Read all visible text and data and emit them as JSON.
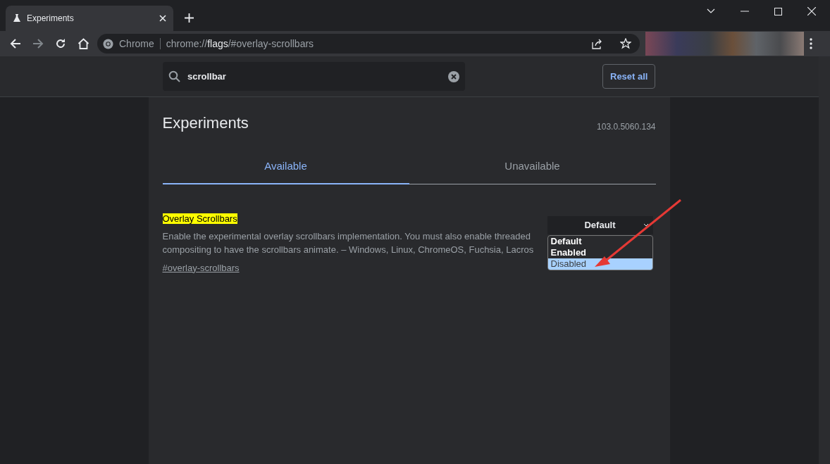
{
  "browser": {
    "tab_title": "Experiments",
    "omnibox_label": "Chrome",
    "url_scheme": "chrome://",
    "url_host": "flags",
    "url_path": "/#overlay-scrollbars"
  },
  "search": {
    "value": "scrollbar"
  },
  "reset_button": "Reset all",
  "title": "Experiments",
  "version": "103.0.5060.134",
  "tabs": [
    {
      "label": "Available",
      "selected": true
    },
    {
      "label": "Unavailable",
      "selected": false
    }
  ],
  "flag": {
    "name": "Overlay Scrollbars",
    "description": "Enable the experimental overlay scrollbars implementation. You must also enable threaded compositing to have the scrollbars animate. – Windows, Linux, ChromeOS, Fuchsia, Lacros",
    "link": "#overlay-scrollbars",
    "value": "Default",
    "options": [
      {
        "label": "Default",
        "highlighted": false
      },
      {
        "label": "Enabled",
        "highlighted": false
      },
      {
        "label": "Disabled",
        "highlighted": true
      }
    ]
  }
}
